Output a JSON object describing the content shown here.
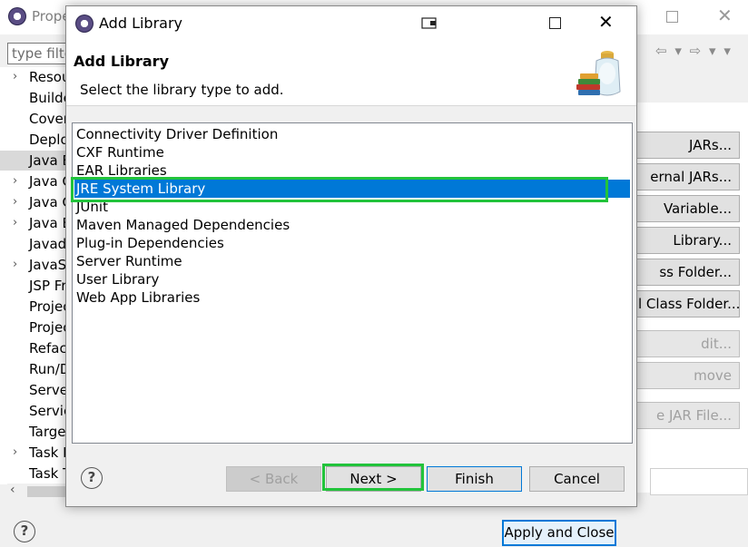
{
  "background_window": {
    "title": "Prope",
    "filter_placeholder": "type filte",
    "tree_items": [
      {
        "label": "Resou",
        "arrow": "›"
      },
      {
        "label": "Builde",
        "arrow": ""
      },
      {
        "label": "Cover",
        "arrow": ""
      },
      {
        "label": "Deplo",
        "arrow": ""
      },
      {
        "label": "Java B",
        "arrow": "",
        "selected": true
      },
      {
        "label": "Java C",
        "arrow": "›"
      },
      {
        "label": "Java C",
        "arrow": "›"
      },
      {
        "label": "Java E",
        "arrow": "›"
      },
      {
        "label": "Javad",
        "arrow": ""
      },
      {
        "label": "JavaS",
        "arrow": "›"
      },
      {
        "label": "JSP Fr",
        "arrow": ""
      },
      {
        "label": "Projec",
        "arrow": ""
      },
      {
        "label": "Projec",
        "arrow": ""
      },
      {
        "label": "Refac",
        "arrow": ""
      },
      {
        "label": "Run/D",
        "arrow": ""
      },
      {
        "label": "Serve",
        "arrow": ""
      },
      {
        "label": "Servic",
        "arrow": ""
      },
      {
        "label": "Targe",
        "arrow": ""
      },
      {
        "label": "Task R",
        "arrow": "›"
      },
      {
        "label": "Task T",
        "arrow": ""
      }
    ],
    "side_buttons": [
      {
        "label": "Add JARs...",
        "visible": "JARs...",
        "disabled": false
      },
      {
        "label": "Add External JARs...",
        "visible": "ernal JARs...",
        "disabled": false
      },
      {
        "label": "Add Variable...",
        "visible": "Variable...",
        "disabled": false
      },
      {
        "label": "Add Library...",
        "visible": "Library...",
        "disabled": false
      },
      {
        "label": "Add Class Folder...",
        "visible": "ss Folder...",
        "disabled": false
      },
      {
        "label": "Add External Class Folder...",
        "visible": "l Class Folder...",
        "disabled": false
      },
      {
        "label": "Edit...",
        "visible": "dit...",
        "disabled": true
      },
      {
        "label": "Remove",
        "visible": "move",
        "disabled": true
      },
      {
        "label": "Migrate JAR File...",
        "visible": "e JAR File...",
        "disabled": true
      }
    ],
    "apply_close_label": "Apply and Close",
    "help_glyph": "?"
  },
  "dialog": {
    "title": "Add Library",
    "heading": "Add Library",
    "description": "Select the library type to add.",
    "libraries": [
      "Connectivity Driver Definition",
      "CXF Runtime",
      "EAR Libraries",
      "JRE System Library",
      "JUnit",
      "Maven Managed Dependencies",
      "Plug-in Dependencies",
      "Server Runtime",
      "User Library",
      "Web App Libraries"
    ],
    "selected_index": 3,
    "buttons": {
      "back": "< Back",
      "next": "Next >",
      "finish": "Finish",
      "cancel": "Cancel"
    },
    "help_glyph": "?"
  },
  "colors": {
    "selection": "#0078d7",
    "highlight": "#22c33b"
  }
}
